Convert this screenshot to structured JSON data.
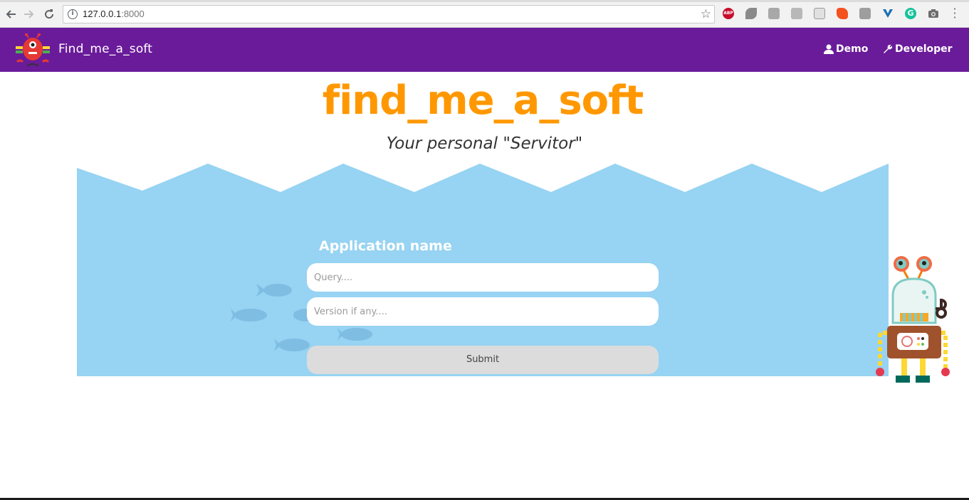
{
  "browser": {
    "url_host": "127.0.0.1",
    "url_port": ":8000",
    "back_icon": "arrow-left-icon",
    "forward_icon": "arrow-right-icon",
    "reload_icon": "reload-icon",
    "bookmark_icon": "star-icon",
    "extensions": [
      "adblock-plus-icon",
      "ext-icon-2",
      "ext-icon-3",
      "pdf-icon",
      "ext-icon-5",
      "ext-icon-6",
      "ext-icon-7",
      "vue-devtools-icon",
      "grammarly-icon",
      "camera-icon"
    ],
    "abp_label": "ABP"
  },
  "navbar": {
    "brand": "Find_me_a_soft",
    "links": [
      {
        "label": "Demo",
        "icon": "user-icon"
      },
      {
        "label": "Developer",
        "icon": "wrench-icon"
      }
    ],
    "background": "#6a1b9a"
  },
  "hero": {
    "title": "find_me_a_soft",
    "subtitle": "Your personal \"Servitor\"",
    "title_color": "#ff9800"
  },
  "search_form": {
    "label": "Application name",
    "query_placeholder": "Query....",
    "version_placeholder": "Version if any....",
    "submit_label": "Submit",
    "water_color": "#97d3f2"
  }
}
